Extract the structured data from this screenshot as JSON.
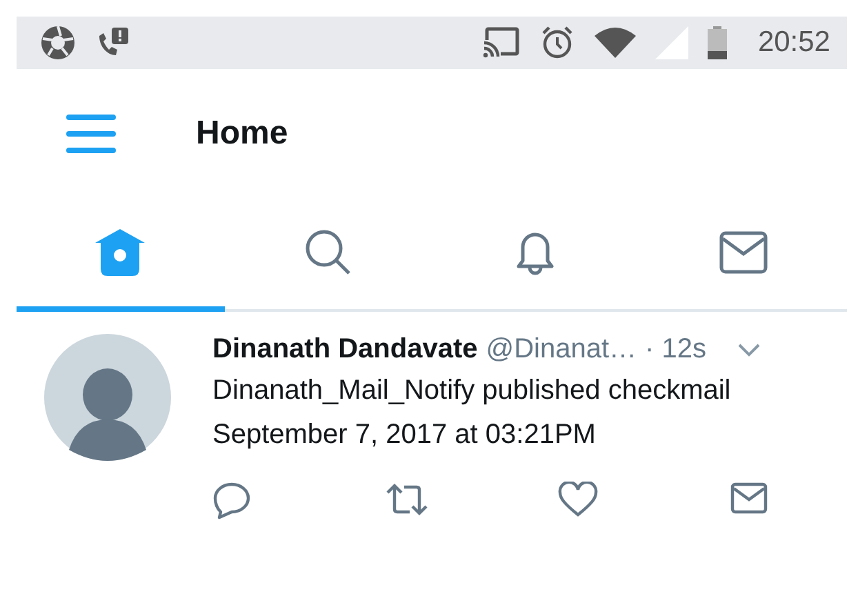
{
  "status_bar": {
    "time": "20:52"
  },
  "header": {
    "title": "Home"
  },
  "tabs": [
    {
      "kind": "home",
      "selected": true
    },
    {
      "kind": "search",
      "selected": false
    },
    {
      "kind": "notifications",
      "selected": false
    },
    {
      "kind": "messages",
      "selected": false
    }
  ],
  "tweet": {
    "name": "Dinanath Dandavate",
    "handle": "@Dinanat…",
    "time": "· 12s",
    "text": "Dinanath_Mail_Notify published checkmail September 7, 2017 at 03:21PM",
    "actions": [
      {
        "kind": "reply"
      },
      {
        "kind": "retweet"
      },
      {
        "kind": "like"
      },
      {
        "kind": "message"
      }
    ]
  }
}
